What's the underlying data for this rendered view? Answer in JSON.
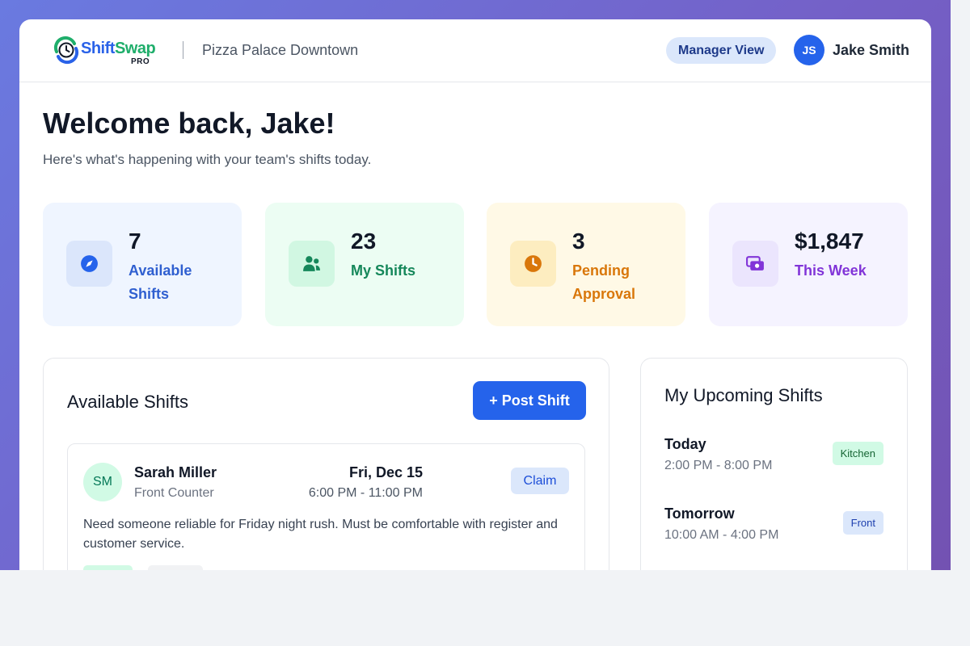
{
  "app": {
    "logo_primary": "Shift",
    "logo_secondary": "Swap",
    "logo_badge": "PRO",
    "location": "Pizza Palace Downtown"
  },
  "header": {
    "manager_view_label": "Manager View",
    "user_initials": "JS",
    "user_name": "Jake Smith"
  },
  "welcome": {
    "title": "Welcome back, Jake!",
    "subtitle": "Here's what's happening with your team's shifts today."
  },
  "stats": [
    {
      "value": "7",
      "label": "Available Shifts",
      "icon": "compass-icon",
      "color": "#2f5fd0",
      "bg": "#eff5ff",
      "icon_bg": "#dbe6fb"
    },
    {
      "value": "23",
      "label": "My Shifts",
      "icon": "users-icon",
      "color": "#15875a",
      "bg": "#ecfdf3",
      "icon_bg": "#d1f7e2"
    },
    {
      "value": "3",
      "label": "Pending Approval",
      "icon": "clock-icon",
      "color": "#d9770a",
      "bg": "#fff9e6",
      "icon_bg": "#fdedc0"
    },
    {
      "value": "$1,847",
      "label": "This Week",
      "icon": "money-icon",
      "color": "#8134d8",
      "bg": "#f5f3ff",
      "icon_bg": "#ebe5fd"
    }
  ],
  "available_shifts": {
    "title": "Available Shifts",
    "post_button": "+ Post Shift",
    "items": [
      {
        "initials": "SM",
        "name": "Sarah Miller",
        "role": "Front Counter",
        "date": "Fri, Dec 15",
        "time": "6:00 PM - 11:00 PM",
        "action": "Claim",
        "description": "Need someone reliable for Friday night rush. Must be comfortable with register and customer service."
      }
    ]
  },
  "upcoming_shifts": {
    "title": "My Upcoming Shifts",
    "items": [
      {
        "day": "Today",
        "time": "2:00 PM - 8:00 PM",
        "tag": "Kitchen",
        "tag_color": "#166534",
        "tag_bg": "#d1fae5"
      },
      {
        "day": "Tomorrow",
        "time": "10:00 AM - 4:00 PM",
        "tag": "Front",
        "tag_color": "#1e40af",
        "tag_bg": "#dbe7fb"
      }
    ]
  }
}
